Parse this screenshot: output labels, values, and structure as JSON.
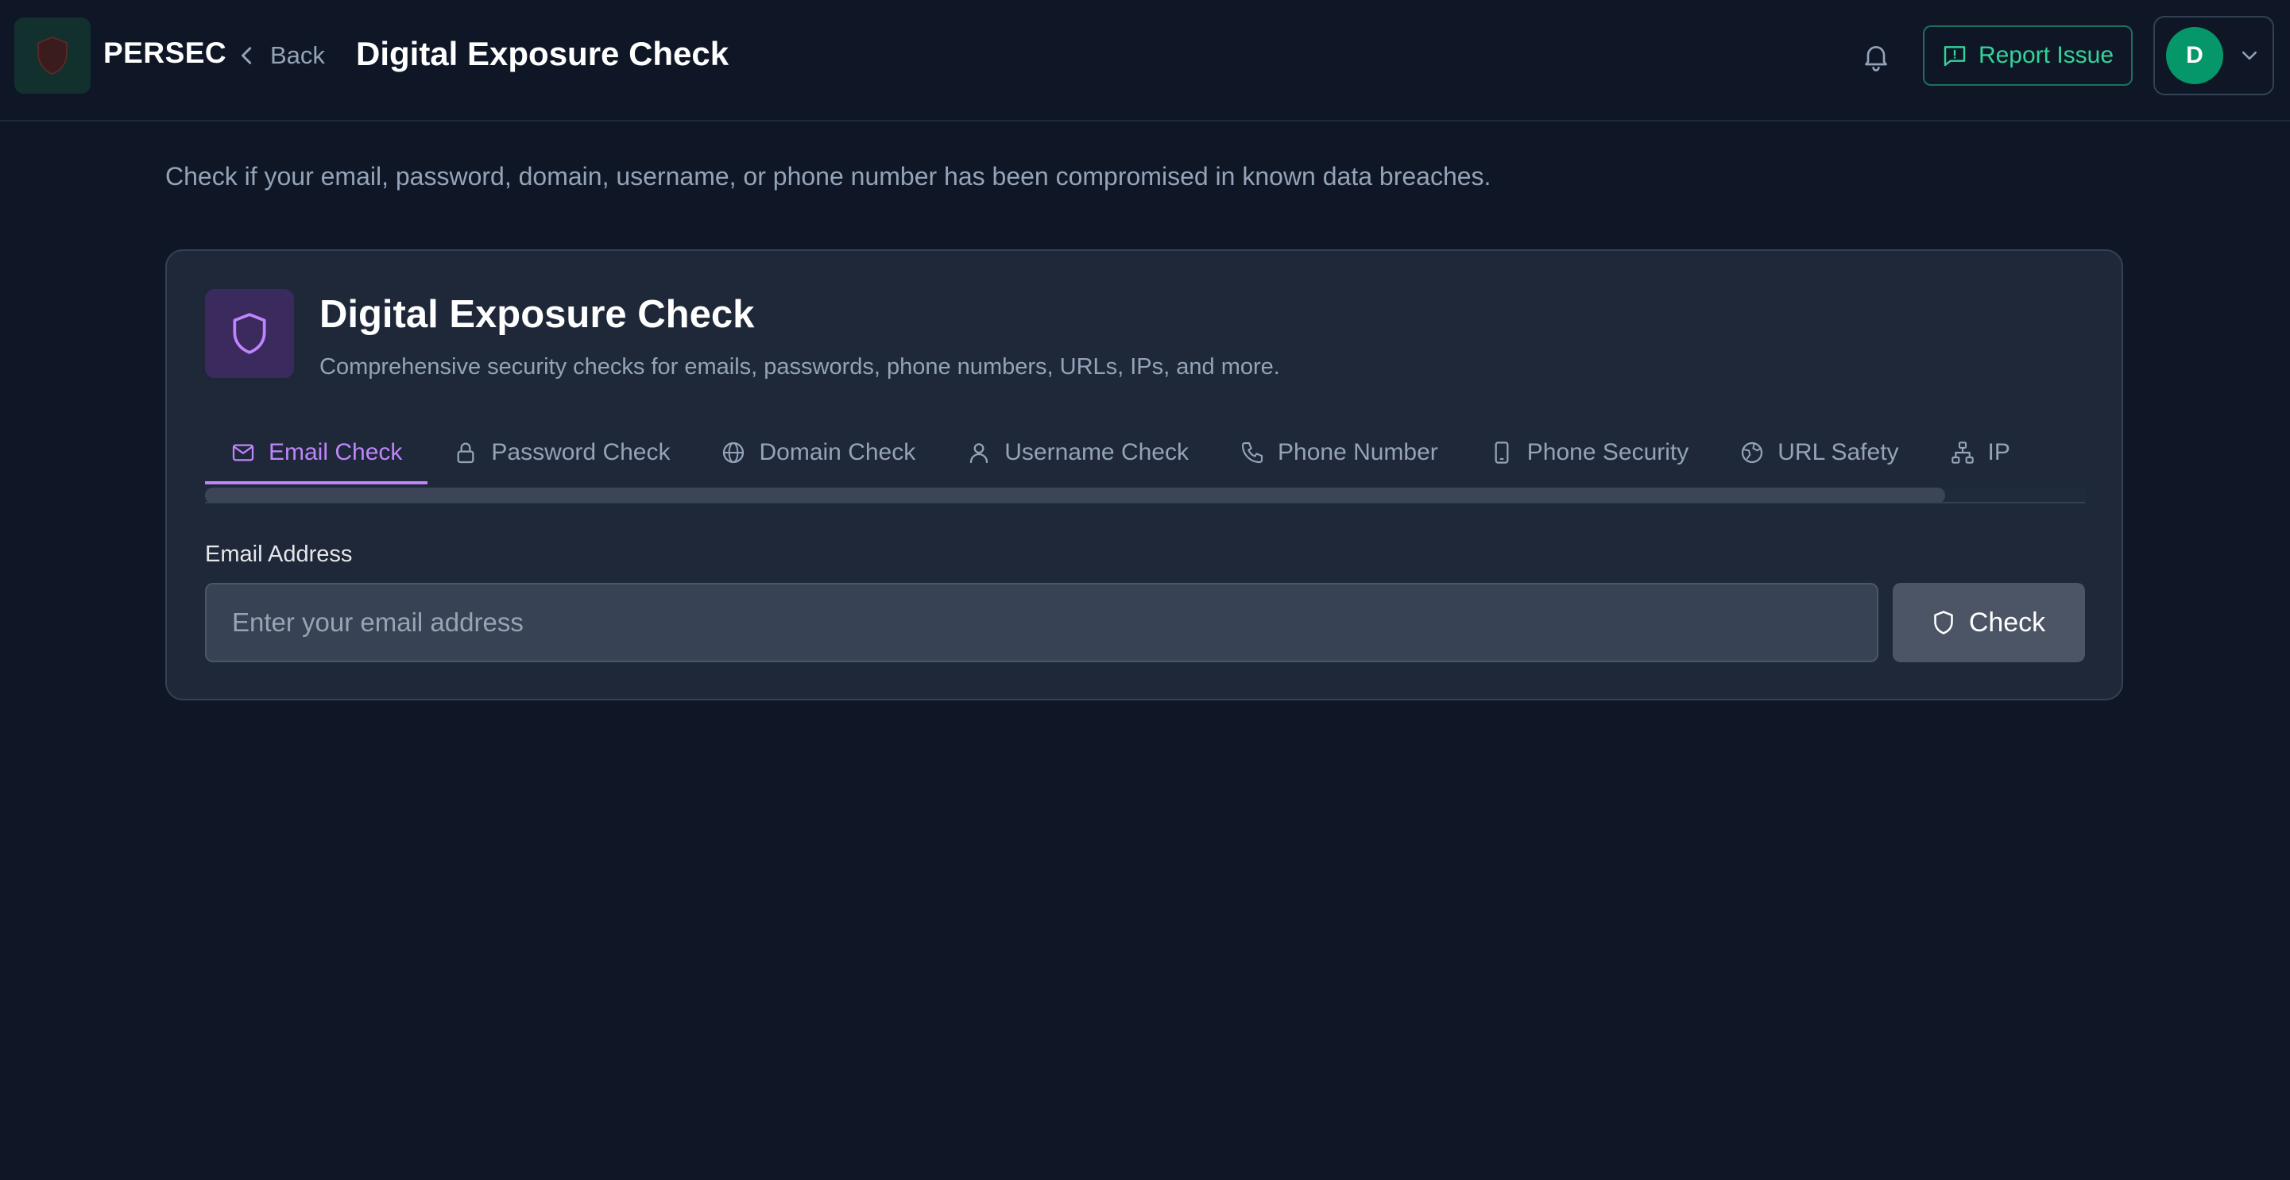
{
  "header": {
    "brand": "PERSEC",
    "back_label": "Back",
    "title": "Digital Exposure Check",
    "report_label": "Report Issue",
    "avatar_initial": "D"
  },
  "intro": "Check if your email, password, domain, username, or phone number has been compromised in known data breaches.",
  "card": {
    "title": "Digital Exposure Check",
    "subtitle": "Comprehensive security checks for emails, passwords, phone numbers, URLs, IPs, and more.",
    "tabs": [
      {
        "label": "Email Check",
        "icon": "mail-icon",
        "active": true
      },
      {
        "label": "Password Check",
        "icon": "lock-icon",
        "active": false
      },
      {
        "label": "Domain Check",
        "icon": "globe-icon",
        "active": false
      },
      {
        "label": "Username Check",
        "icon": "user-icon",
        "active": false
      },
      {
        "label": "Phone Number",
        "icon": "phone-icon",
        "active": false
      },
      {
        "label": "Phone Security",
        "icon": "smartphone-icon",
        "active": false
      },
      {
        "label": "URL Safety",
        "icon": "globe-lock-icon",
        "active": false
      },
      {
        "label": "IP",
        "icon": "network-icon",
        "active": false
      }
    ],
    "field_label": "Email Address",
    "email_placeholder": "Enter your email address",
    "check_label": "Check"
  },
  "colors": {
    "background": "#0f1726",
    "card": "#1e2838",
    "accent_purple": "#c084fc",
    "accent_green": "#34d399",
    "avatar": "#059669"
  }
}
